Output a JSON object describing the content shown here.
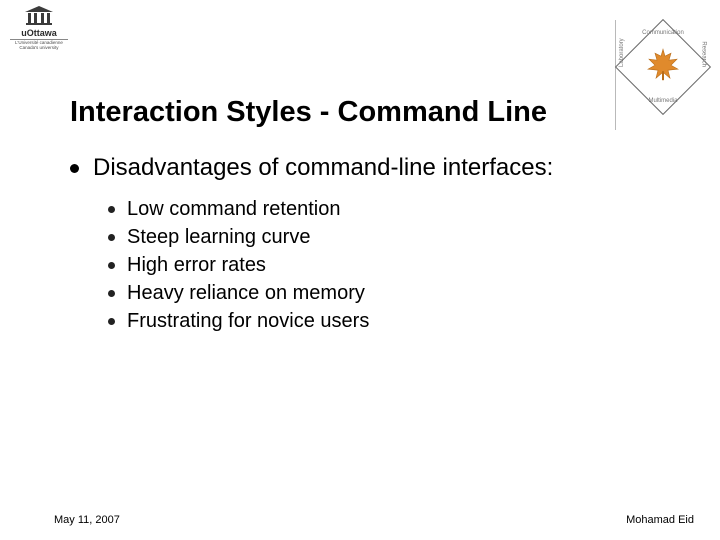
{
  "logo_left": {
    "name": "uOttawa",
    "tagline": "L'Université canadienne\nCanada's university"
  },
  "logo_right": {
    "top": "Communication",
    "right": "Research",
    "bottom": "Multimedia",
    "left": "Laboratory"
  },
  "title": "Interaction Styles - Command Line",
  "main_bullet": "Disadvantages of command-line interfaces:",
  "sub_bullets": [
    "Low command retention",
    "Steep learning curve",
    "High error rates",
    "Heavy reliance on memory",
    "Frustrating for novice users"
  ],
  "footer": {
    "date": "May 11, 2007",
    "author": "Mohamad Eid"
  }
}
